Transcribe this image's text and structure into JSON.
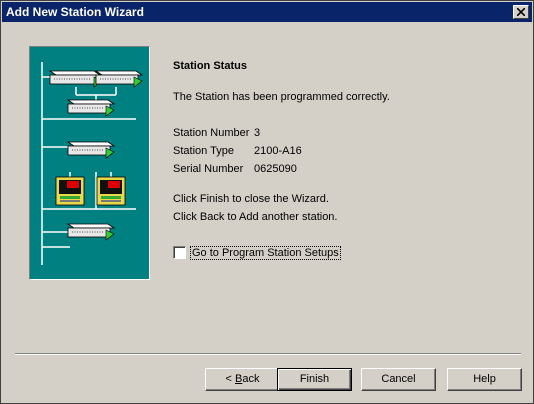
{
  "window": {
    "title": "Add New Station Wizard"
  },
  "status": {
    "heading": "Station Status",
    "message": "The Station has been programmed correctly.",
    "station_number_label": "Station Number",
    "station_number_value": "3",
    "station_type_label": "Station Type",
    "station_type_value": "2100-A16",
    "serial_number_label": "Serial Number",
    "serial_number_value": "0625090",
    "finish_hint": "Click Finish to close the Wizard.",
    "back_hint": "Click Back to Add another station."
  },
  "checkbox": {
    "label": "Go to Program Station Setups",
    "checked": false
  },
  "buttons": {
    "back_prefix": "< ",
    "back_mnemonic": "B",
    "back_rest": "ack",
    "finish": "Finish",
    "cancel": "Cancel",
    "help": "Help"
  },
  "colors": {
    "titlebar": "#0a246a",
    "art_background": "#008080",
    "face": "#d4d0c8"
  },
  "icons": [
    "close-icon",
    "network-device-icon",
    "controller-display-icon"
  ]
}
